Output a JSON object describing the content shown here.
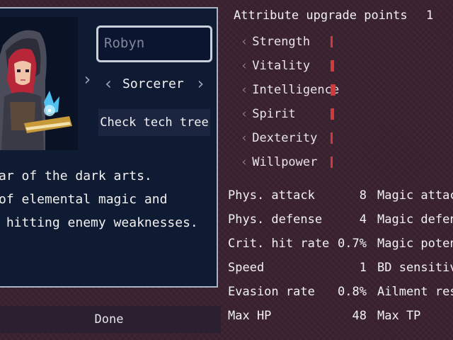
{
  "character": {
    "name": "Robyn",
    "class_name": "Sorcerer",
    "tech_tree_label": "Check tech tree",
    "description_lines": [
      "ar of the dark arts.",
      "of elemental magic and",
      " hitting enemy weaknesses."
    ]
  },
  "done_label": "Done",
  "attributes": {
    "title": "Attribute upgrade points",
    "points": "1",
    "items": [
      {
        "label": "Strength",
        "level": 1
      },
      {
        "label": "Vitality",
        "level": 2
      },
      {
        "label": "Intelligence",
        "level": 3
      },
      {
        "label": "Spirit",
        "level": 2
      },
      {
        "label": "Dexterity",
        "level": 1
      },
      {
        "label": "Willpower",
        "level": 1
      }
    ],
    "bar_color": "#d23a3a"
  },
  "stats": {
    "left": [
      {
        "label": "Phys. attack",
        "value": "8"
      },
      {
        "label": "Phys. defense",
        "value": "4"
      },
      {
        "label": "Crit. hit rate",
        "value": "0.7%"
      },
      {
        "label": "Speed",
        "value": "1"
      },
      {
        "label": "Evasion rate",
        "value": "0.8%"
      },
      {
        "label": "Max HP",
        "value": "48"
      }
    ],
    "right": [
      {
        "label": "Magic attac"
      },
      {
        "label": "Magic defen"
      },
      {
        "label": "Magic poten"
      },
      {
        "label": "BD sensitivit"
      },
      {
        "label": "Ailment res."
      },
      {
        "label": "Max TP"
      }
    ]
  }
}
